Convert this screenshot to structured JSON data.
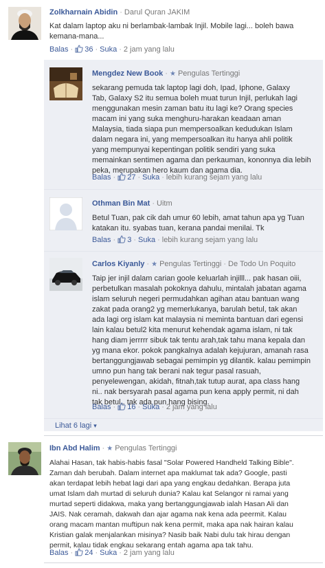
{
  "comments": [
    {
      "name": "Zolkharnain Abidin",
      "affiliation": "Darul Quran JAKIM",
      "text": "Kat dalam laptop aku ni berlambak-lambak Injil. Mobile lagi... boleh bawa\nkemana-mana...",
      "reply_label": "Balas",
      "likes": "36",
      "like_label": "Suka",
      "time": "2 jam yang lalu"
    }
  ],
  "replies": [
    {
      "name": "Mengdez New Book",
      "badge": "Pengulas Tertinggi",
      "text": "sekarang pemuda tak laptop lagi doh, Ipad, Iphone, Galaxy\nTab, Galaxy S2 itu semua boleh muat turun Injil, perlukah lagi\nmenggunakan mesin zaman batu itu lagi ke? Orang species\nmacam ini yang suka menghuru-harakan keadaan aman\nMalaysia, tiada siapa pun mempersoalkan kedudukan Islam\ndalam negara ini, yang mempersoalkan itu hanya ahli politik\nyang mempunyai kepentingan politik sendiri yang suka\nmemainkan sentimen agama dan perkauman, kononnya dia lebih\npeka, merupakan hero kaum dan agama dia.",
      "reply_label": "Balas",
      "likes": "27",
      "like_label": "Suka",
      "time": "lebih kurang sejam yang lalu"
    },
    {
      "name": "Othman Bin Mat",
      "affiliation": "Uitm",
      "text": "Betul Tuan, pak cik dah umur 60 lebih, amat tahun apa yg Tuan\nkatakan itu. syabas tuan, kerana pandai menilai. Tk",
      "reply_label": "Balas",
      "likes": "3",
      "like_label": "Suka",
      "time": "lebih kurang sejam yang lalu"
    },
    {
      "name": "Carlos Kiyanly",
      "badge": "Pengulas Tertinggi",
      "affiliation": "De Todo Un Poquito",
      "text": "Taip jer injil dalam carian goole keluarlah injilll... pak hasan oiii,\nperbetulkan masalah pokoknya dahulu, mintalah jabatan agama\nislam seluruh negeri permudahkan agihan atau bantuan wang\nzakat pada orang2 yg memerlukanya, barulah betul, tak akan\nada lagi org islam kat malaysia ni meminta bantuan dari egensi\nlain kalau betul2 kita menurut kehendak agama islam, ni tak\nhang diam jerrrrr sibuk tak tentu arah,tak tahu mana kepala dan\nyg mana ekor. pokok pangkalnya adalah kejujuran, amanah rasa\nbertanggungjawab sebagai pemimpin yg dilantik. kalau pemimpin\numno pun hang tak berani nak tegur pasal rasuah,\npenyelewengan, akidah, fitnah,tak tutup aurat, apa class hang\nni.. nak bersyarah pasal agama pun kena apply permit, ni dah\ntak betul.. tak ada pun hang bising.",
      "reply_label": "Balas",
      "likes": "16",
      "like_label": "Suka",
      "time": "2 jam yang lalu"
    }
  ],
  "view_more": "Lihat 6 lagi",
  "comment2": {
    "name": "Ibn Abd Halim",
    "badge": "Pengulas Tertinggi",
    "text": "Alahai Hasan, tak habis-habis fasal \"Solar Powered Handheld Talking Bible\".\nZaman dah berubah. Dalam internet apa maklumat tak ada? Google, pasti\nakan terdapat lebih hebat lagi dari apa yang engkau dedahkan. Berapa juta\numat Islam dah murtad di seluruh dunia? Kalau kat Selangor ni ramai yang\nmurtad seperti didakwa, maka yang bertanggungjawab ialah Hasan Ali dan\nJAIS. Nak ceramah, dakwah dan ajar agama nak kena ada peermit. Kalau\norang macam mantan muftipun nak kena permit, maka apa nak hairan kalau\nKristian galak menjalankan misinya? Nasib baik Nabi dulu tak hirau dengan\npermit, kalau tidak engkau sekarang entah agama apa tak tahu.",
    "reply_label": "Balas",
    "likes": "24",
    "like_label": "Suka",
    "time": "2 jam yang lalu"
  },
  "colors": {
    "link": "#3b5998",
    "reply_bg": "#edeff4",
    "meta": "#777777"
  }
}
